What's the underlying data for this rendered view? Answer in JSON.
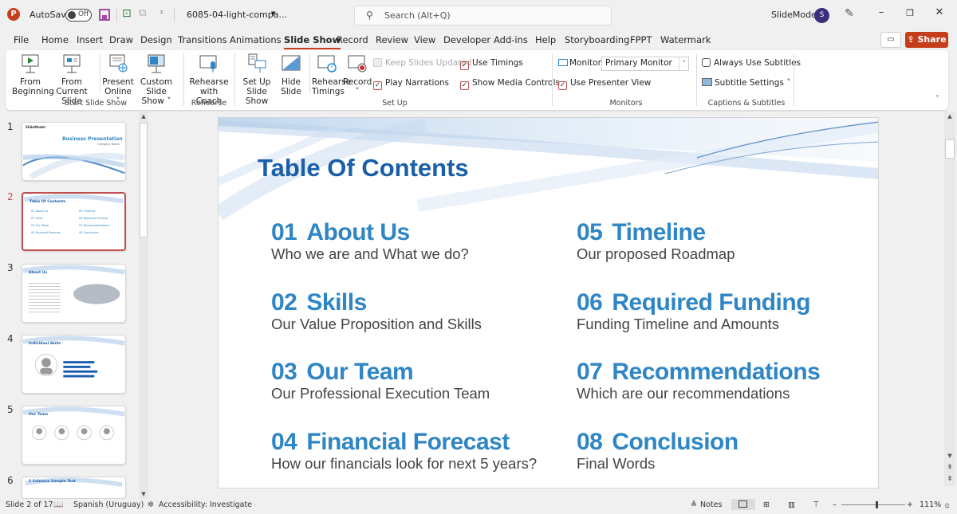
{
  "titlebar": {
    "app_icon": "powerpoint-icon",
    "autosave_label": "AutoSave",
    "autosave_state": "Off",
    "filename": "6085-04-light-compa...",
    "search_placeholder": "Search (Alt+Q)",
    "user_name": "SlideModel",
    "user_initial": "S"
  },
  "menu": {
    "tabs": [
      "File",
      "Home",
      "Insert",
      "Draw",
      "Design",
      "Transitions",
      "Animations",
      "Slide Show",
      "Record",
      "Review",
      "View",
      "Developer",
      "Add-ins",
      "Help",
      "Storyboarding",
      "FPPT",
      "Watermark"
    ],
    "active_tab": "Slide Show",
    "share_label": "Share"
  },
  "ribbon": {
    "groups": {
      "start": "Start Slide Show",
      "rehearse": "Rehearse",
      "setup": "Set Up",
      "monitors": "Monitors",
      "captions": "Captions & Subtitles"
    },
    "buttons": {
      "from_beginning": [
        "From",
        "Beginning"
      ],
      "from_current": [
        "From",
        "Current Slide"
      ],
      "present_online": [
        "Present",
        "Online ˅"
      ],
      "custom_show": [
        "Custom Slide",
        "Show ˅"
      ],
      "rehearse_coach": [
        "Rehearse",
        "with Coach"
      ],
      "setup_show": [
        "Set Up",
        "Slide Show"
      ],
      "hide_slide": [
        "Hide",
        "Slide"
      ],
      "rehearse_timings": [
        "Rehearse",
        "Timings"
      ],
      "record": [
        "Record",
        "˅"
      ]
    },
    "checkboxes": {
      "keep_updated": {
        "label": "Keep Slides Updated",
        "checked": false,
        "disabled": true
      },
      "use_timings": {
        "label": "Use Timings",
        "checked": true
      },
      "play_narrations": {
        "label": "Play Narrations",
        "checked": true
      },
      "show_media": {
        "label": "Show Media Controls",
        "checked": true
      },
      "presenter_view": {
        "label": "Use Presenter View",
        "checked": true
      },
      "always_subtitles": {
        "label": "Always Use Subtitles",
        "checked": false
      }
    },
    "monitor_label": "Monitor:",
    "monitor_value": "Primary Monitor",
    "subtitle_settings": "Subtitle Settings ˅"
  },
  "thumbnails": [
    {
      "num": "1",
      "title": "Business Presentation",
      "subtitle": "Company Name"
    },
    {
      "num": "2",
      "title": "Table Of Contents",
      "selected": true
    },
    {
      "num": "3",
      "title": "About Us"
    },
    {
      "num": "4",
      "title": "Individual Skills"
    },
    {
      "num": "5",
      "title": "Our Team"
    },
    {
      "num": "6",
      "title": "2 Columns Sample Text"
    }
  ],
  "slide": {
    "title": "Table Of Contents",
    "items": [
      {
        "num": "01",
        "head": "About Us",
        "sub": "Who we are and What we do?"
      },
      {
        "num": "02",
        "head": "Skills",
        "sub": "Our Value Proposition and Skills"
      },
      {
        "num": "03",
        "head": "Our Team",
        "sub": "Our Professional Execution Team"
      },
      {
        "num": "04",
        "head": "Financial Forecast",
        "sub": "How our financials look for next 5 years?"
      },
      {
        "num": "05",
        "head": "Timeline",
        "sub": "Our proposed Roadmap"
      },
      {
        "num": "06",
        "head": "Required Funding",
        "sub": "Funding Timeline and Amounts"
      },
      {
        "num": "07",
        "head": "Recommendations",
        "sub": "Which are our recommendations"
      },
      {
        "num": "08",
        "head": "Conclusion",
        "sub": "Final Words"
      }
    ]
  },
  "status": {
    "slide_info": "Slide 2 of 17",
    "language": "Spanish (Uruguay)",
    "accessibility": "Accessibility: Investigate",
    "notes": "Notes",
    "zoom": "111%",
    "zoom_fraction": 0.55
  },
  "colors": {
    "accent": "#c43e1c",
    "title_blue": "#1a5fa8",
    "heading_blue": "#2f86c4"
  }
}
